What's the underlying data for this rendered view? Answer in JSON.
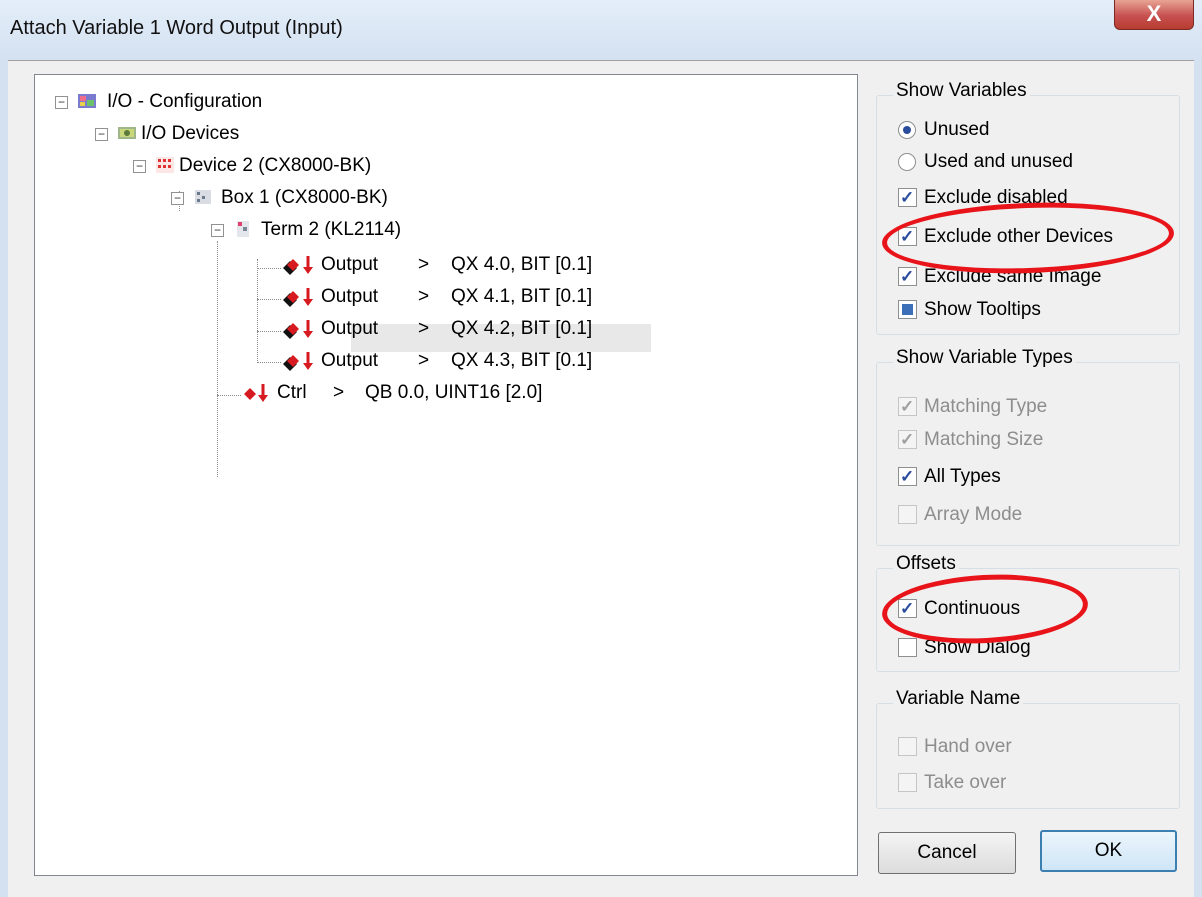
{
  "window": {
    "title": "Attach Variable 1 Word Output (Input)",
    "close_glyph": "X"
  },
  "tree": {
    "root": "I/O - Configuration",
    "devices": "I/O Devices",
    "device2": "Device 2 (CX8000-BK)",
    "box1": "Box 1 (CX8000-BK)",
    "term2": "Term 2 (KL2114)",
    "outputs": [
      {
        "name": "Output",
        "arrow": ">",
        "addr": "QX 4.0, BIT [0.1]"
      },
      {
        "name": "Output",
        "arrow": ">",
        "addr": "QX 4.1, BIT [0.1]"
      },
      {
        "name": "Output",
        "arrow": ">",
        "addr": "QX 4.2, BIT [0.1]"
      },
      {
        "name": "Output",
        "arrow": ">",
        "addr": "QX 4.3, BIT [0.1]"
      }
    ],
    "ctrl": {
      "name": "Ctrl",
      "arrow": ">",
      "addr": "QB 0.0, UINT16 [2.0]"
    }
  },
  "show_variables": {
    "label": "Show Variables",
    "unused": "Unused",
    "used_unused": "Used and unused",
    "exclude_disabled": "Exclude disabled",
    "exclude_other": "Exclude other Devices",
    "exclude_same": "Exclude same Image",
    "tooltips": "Show Tooltips"
  },
  "show_types": {
    "label": "Show Variable Types",
    "matching_type": "Matching Type",
    "matching_size": "Matching Size",
    "all_types": "All Types",
    "array_mode": "Array Mode"
  },
  "offsets": {
    "label": "Offsets",
    "continuous": "Continuous",
    "show_dialog": "Show Dialog"
  },
  "variable_name": {
    "label": "Variable Name",
    "hand_over": "Hand over",
    "take_over": "Take over"
  },
  "buttons": {
    "cancel": "Cancel",
    "ok": "OK"
  },
  "colors": {
    "annotation": "#e8141a",
    "accent": "#2a4c9c"
  }
}
